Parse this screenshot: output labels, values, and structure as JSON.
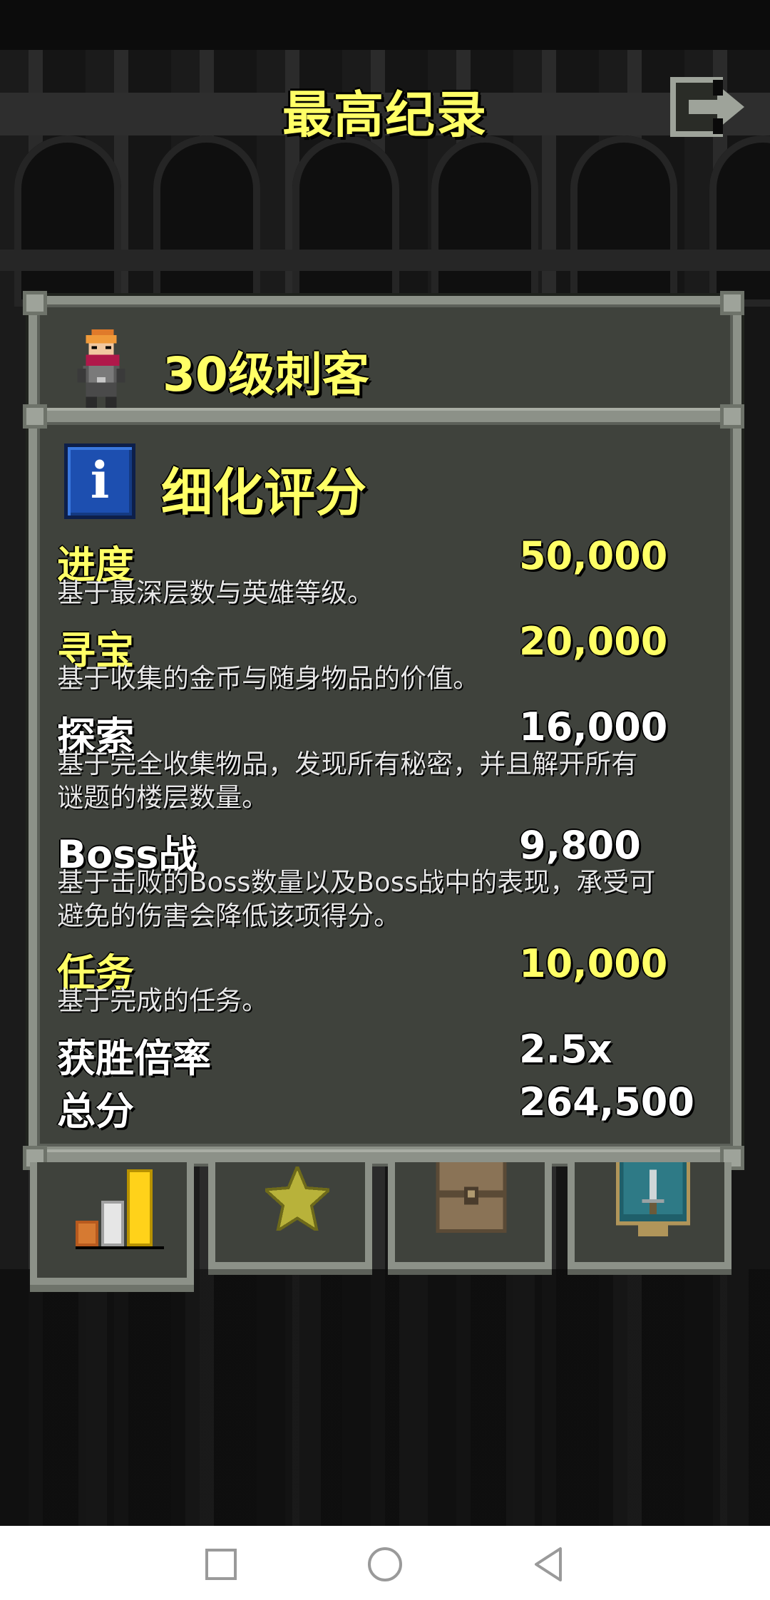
{
  "screen_title": "最高纪录",
  "hero": {
    "name": "30级刺客"
  },
  "section_title": "细化评分",
  "info_icon_glyph": "i",
  "score_rows": [
    {
      "label": "进度",
      "value": "50,000",
      "color": "#ffff66",
      "desc_lines": [
        "基于最深层数与英雄等级。"
      ]
    },
    {
      "label": "寻宝",
      "value": "20,000",
      "color": "#ffff66",
      "desc_lines": [
        "基于收集的金币与随身物品的价值。"
      ]
    },
    {
      "label": "探索",
      "value": "16,000",
      "color": "#ffffff",
      "desc_lines": [
        "基于完全收集物品，发现所有秘密，并且解开所有",
        "谜题的楼层数量。"
      ]
    },
    {
      "label": "Boss战",
      "value": "9,800",
      "color": "#ffffff",
      "desc_lines": [
        "基于击败的Boss数量以及Boss战中的表现，承受可",
        "避免的伤害会降低该项得分。"
      ]
    },
    {
      "label": "任务",
      "value": "10,000",
      "color": "#ffff66",
      "desc_lines": [
        "基于完成的任务。"
      ]
    }
  ],
  "multiplier": {
    "label": "获胜倍率",
    "value": "2.5x"
  },
  "total": {
    "label": "总分",
    "value": "264,500"
  },
  "tabs": [
    {
      "icon": "stats-bars-icon",
      "active": true
    },
    {
      "icon": "star-icon",
      "active": false
    },
    {
      "icon": "chest-icon",
      "active": false
    },
    {
      "icon": "sword-badge-icon",
      "active": false
    }
  ],
  "colors": {
    "title": "#ffff66",
    "panel": "#3f423c",
    "border": "#8c9188"
  }
}
